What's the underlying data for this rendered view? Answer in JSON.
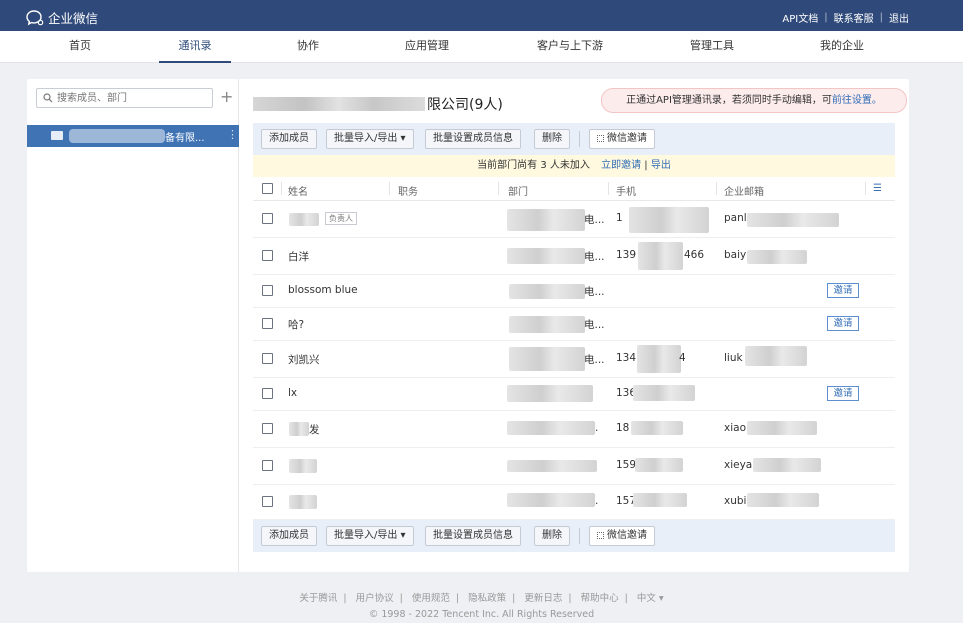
{
  "app": {
    "title": "企业微信"
  },
  "toplinks": [
    "API文档",
    "联系客服",
    "退出"
  ],
  "nav": [
    "首页",
    "通讯录",
    "协作",
    "应用管理",
    "客户与上下游",
    "管理工具",
    "我的企业"
  ],
  "sidebar": {
    "search_placeholder": "搜索成员、部门",
    "dept_label": "备有限..."
  },
  "main": {
    "title_suffix": "限公司(9人)",
    "notice_text": "正通过API管理通讯录，若须同时手动编辑，可",
    "notice_link": "前往设置。",
    "toolbar": {
      "add": "添加成员",
      "import": "批量导入/导出 ▾",
      "batch": "批量设置成员信息",
      "delete": "删除",
      "wechat": "微信邀请"
    },
    "invite_bar": {
      "text": "当前部门尚有 3 人未加入",
      "link1": "立即邀请",
      "sep": "|",
      "link2": "导出"
    },
    "columns": [
      "姓名",
      "职务",
      "部门",
      "手机",
      "企业邮箱"
    ],
    "rows": [
      {
        "name": "",
        "tag": "负责人",
        "dept": "电...",
        "phone": "1",
        "email": "panl",
        "invite": ""
      },
      {
        "name": "白洋",
        "tag": "",
        "dept": "电...",
        "phone": "139",
        "phone_tail": "466",
        "email": "baiy",
        "invite": ""
      },
      {
        "name": "blossom blue",
        "tag": "",
        "dept": "电...",
        "phone": "",
        "email": "",
        "invite": "邀请"
      },
      {
        "name": "哈?",
        "tag": "",
        "dept": "电...",
        "phone": "",
        "email": "",
        "invite": "邀请"
      },
      {
        "name": "刘凯兴",
        "tag": "",
        "dept": "电...",
        "phone": "134",
        "phone_tail": "4",
        "email": "liuk",
        "invite": ""
      },
      {
        "name": "lx",
        "tag": "",
        "dept": "",
        "phone": "136",
        "email": "",
        "invite": "邀请"
      },
      {
        "name": "发",
        "tag": "",
        "dept": ".",
        "phone": "18",
        "email": "xiao",
        "invite": ""
      },
      {
        "name": "",
        "tag": "",
        "dept": "",
        "phone": "159",
        "email": "xieya",
        "invite": ""
      },
      {
        "name": "",
        "tag": "",
        "dept": ".",
        "phone": "157",
        "email": "xubi",
        "invite": ""
      }
    ]
  },
  "footer": {
    "links": [
      "关于腾讯",
      "用户协议",
      "使用规范",
      "隐私政策",
      "更新日志",
      "帮助中心",
      "中文 ▾"
    ],
    "copyright": "© 1998 - 2022 Tencent Inc. All Rights Reserved"
  },
  "colors": {
    "topbar": "#2f4a7a",
    "accent": "#3f73b4",
    "link": "#2f6bb6"
  }
}
